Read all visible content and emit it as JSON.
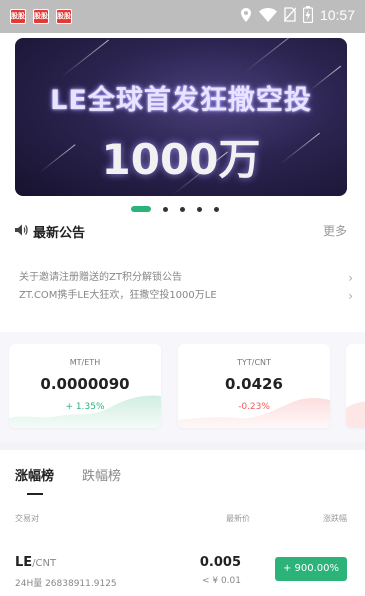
{
  "status_bar": {
    "notifications": [
      "股股",
      "股股",
      "股股"
    ],
    "time": "10:57",
    "icons": [
      "location-icon",
      "wifi-icon",
      "no-sim-icon",
      "battery-icon"
    ]
  },
  "banner": {
    "title": "LE全球首发狂撒空投",
    "subtitle": "1000万",
    "page_count": 5,
    "active_page": 0
  },
  "announcements": {
    "title": "最新公告",
    "more_label": "更多",
    "items": [
      "关于邀请注册赠送的ZT积分解锁公告",
      "ZT.COM携手LE大狂欢，狂撒空投1000万LE"
    ]
  },
  "tickers": [
    {
      "pair": "MT/ETH",
      "price": "0.0000090",
      "change": "+ 1.35%",
      "trend": "up"
    },
    {
      "pair": "TYT/CNT",
      "price": "0.0426",
      "change": "-0.23%",
      "trend": "down"
    }
  ],
  "rankings": {
    "tabs": [
      "涨幅榜",
      "跌幅榜"
    ],
    "active_tab": 0,
    "columns": [
      "交易对",
      "最新价",
      "涨跌幅"
    ],
    "rows": [
      {
        "base": "LE",
        "quote": "/CNT",
        "volume": "24H量 26838911.9125",
        "last": "0.005",
        "cny": "< ¥ 0.01",
        "change": "+ 900.00%"
      }
    ]
  },
  "colors": {
    "accent": "#2bb37a",
    "down": "#f05a5a",
    "banner_bg": "#2b2450"
  }
}
